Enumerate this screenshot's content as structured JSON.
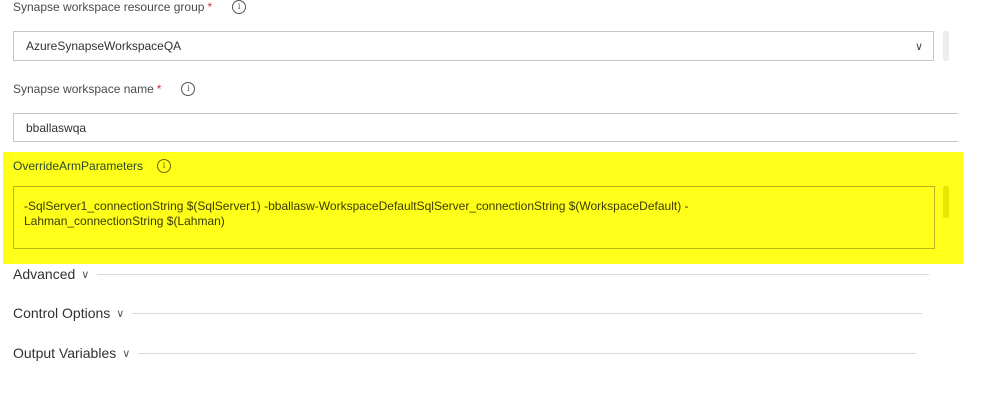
{
  "resource_group": {
    "label": "Synapse workspace resource group",
    "required_mark": "*",
    "value": "AzureSynapseWorkspaceQA"
  },
  "workspace_name": {
    "label": "Synapse workspace name",
    "required_mark": "*",
    "value": "bballaswqa"
  },
  "override_arm": {
    "label": "OverrideArmParameters",
    "value": "-SqlServer1_connectionString $(SqlServer1) -bballasw-WorkspaceDefaultSqlServer_connectionString $(WorkspaceDefault) -\nLahman_connectionString $(Lahman)",
    "highlight_color": "#ffff1a"
  },
  "sections": {
    "advanced": "Advanced",
    "control_options": "Control Options",
    "output_variables": "Output Variables"
  },
  "icons": {
    "info": "i",
    "chevron_down": "∨"
  }
}
